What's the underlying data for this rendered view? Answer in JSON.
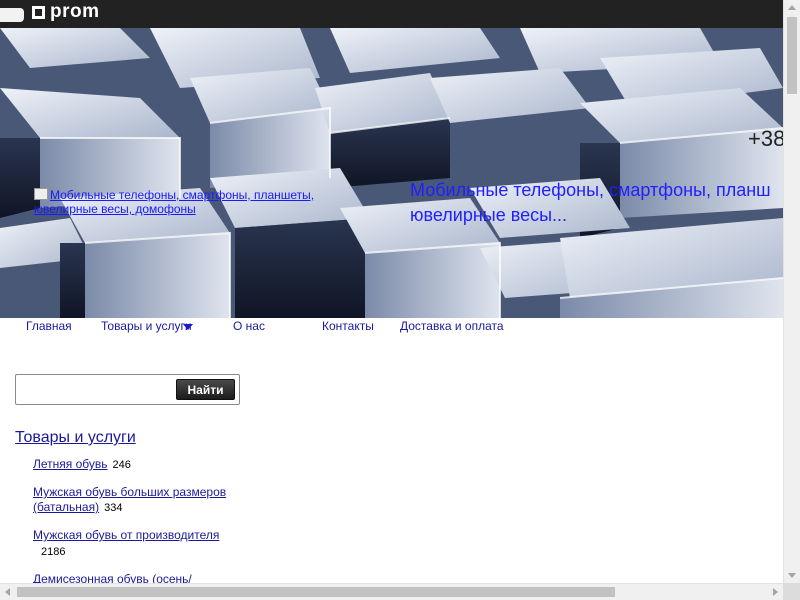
{
  "topbar": {
    "brand": "prom",
    "menu_icon": "menu-icon",
    "logo_icon": "prom-logo-icon"
  },
  "header": {
    "logo_alt": "Мобильные телефоны, смартфоны, планшеты, ювелирные весы, домофоны",
    "slogan_line1": "Мобильные телефоны, смартфоны, планш",
    "slogan_line2": "ювелирные весы...",
    "phone": "+38"
  },
  "nav": {
    "items": [
      {
        "label": "Главная"
      },
      {
        "label": "Товары и услуги"
      },
      {
        "label": "О нас"
      },
      {
        "label": "Контакты"
      },
      {
        "label": "Доставка и оплата"
      }
    ]
  },
  "search": {
    "value": "",
    "placeholder": "",
    "button_label": "Найти"
  },
  "catalog": {
    "title": "Товары и услуги",
    "items": [
      {
        "label": "Летняя обувь",
        "count": "246"
      },
      {
        "label": "Мужская обувь больших размеров (батальная)",
        "count": "334"
      },
      {
        "label": "Мужская обувь от производителя",
        "count": "2186"
      },
      {
        "label": "Демисезонная обувь (осень/",
        "count": ""
      }
    ]
  },
  "colors": {
    "topbar": "#222222",
    "link": "#1a1a99",
    "slogan": "#1f1fff"
  }
}
